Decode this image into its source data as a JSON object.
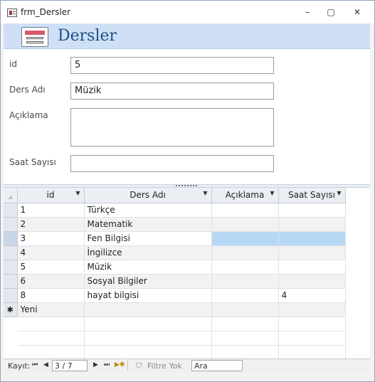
{
  "window": {
    "title": "frm_Dersler",
    "minimize": "–",
    "maximize": "▢",
    "close": "✕"
  },
  "form": {
    "title": "Dersler",
    "fields": [
      {
        "label": "id",
        "value": "5"
      },
      {
        "label": "Ders Adı",
        "value": "Müzik"
      },
      {
        "label": "Açıklama",
        "value": ""
      },
      {
        "label": "Saat Sayısı",
        "value": ""
      }
    ]
  },
  "datasheet": {
    "columns": [
      "id",
      "Ders Adı",
      "Açıklama",
      "Saat Sayısı"
    ],
    "rows": [
      {
        "id": "1",
        "ders_adi": "Türkçe",
        "aciklama": "",
        "saat": ""
      },
      {
        "id": "2",
        "ders_adi": "Matematik",
        "aciklama": "",
        "saat": ""
      },
      {
        "id": "3",
        "ders_adi": "Fen Bilgisi",
        "aciklama": "",
        "saat": ""
      },
      {
        "id": "4",
        "ders_adi": "İngilizce",
        "aciklama": "",
        "saat": ""
      },
      {
        "id": "5",
        "ders_adi": "Müzik",
        "aciklama": "",
        "saat": ""
      },
      {
        "id": "6",
        "ders_adi": "Sosyal Bilgiler",
        "aciklama": "",
        "saat": ""
      },
      {
        "id": "8",
        "ders_adi": "hayat bilgisi",
        "aciklama": "",
        "saat": "4"
      }
    ],
    "new_row_marker": "✱",
    "new_row_label": "Yeni",
    "current_row_index": 2
  },
  "navigation": {
    "record_label": "Kayıt:",
    "first": "⏮",
    "prev": "◀",
    "position": "3 / 7",
    "next": "▶",
    "last": "⏭",
    "new": "▶✱",
    "filter_label": "Filtre Yok",
    "search_placeholder": "Ara"
  }
}
